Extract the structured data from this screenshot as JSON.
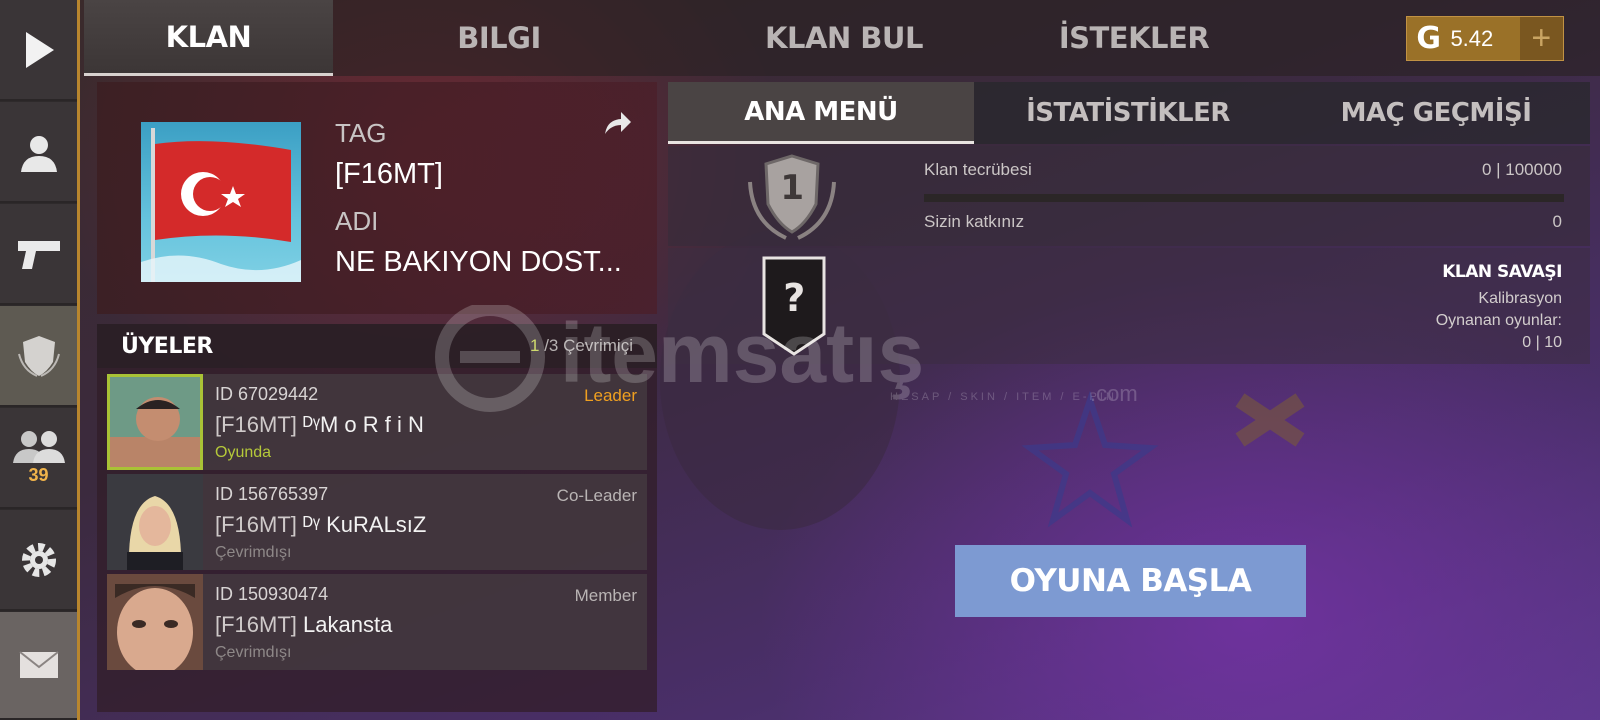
{
  "tabs": [
    "KLAN",
    "BILGI",
    "KLAN BUL",
    "İSTEKLER"
  ],
  "currency": {
    "symbol": "G",
    "value": "5.42",
    "add": "+"
  },
  "sidebar": {
    "friends_count": "39"
  },
  "clan": {
    "tag_label": "TAG",
    "tag_value": "[F16MT]",
    "name_label": "ADI",
    "name_value": "NE BAKIYON DOST..."
  },
  "members": {
    "title": "ÜYELER",
    "online_count": "1",
    "online_rest": "/3 Çevrimiçi",
    "rows": [
      {
        "id": "ID 67029442",
        "role": "Leader",
        "tag": "[F16MT]",
        "name": "ᴰᵞM o R f i N",
        "status": "Oyunda"
      },
      {
        "id": "ID 156765397",
        "role": "Co-Leader",
        "tag": "[F16MT]",
        "name": "ᴰᵞ KuRALsıZ",
        "status": "Çevrimdışı"
      },
      {
        "id": "ID 150930474",
        "role": "Member",
        "tag": "[F16MT]",
        "name": "Lakansta",
        "status": "Çevrimdışı"
      }
    ]
  },
  "subtabs": [
    "ANA MENÜ",
    "İSTATİSTİKLER",
    "MAÇ GEÇMİŞİ"
  ],
  "level": "1",
  "rank_badge": "?",
  "xp": {
    "label": "Klan tecrübesi",
    "value": "0 | 100000",
    "progress": 0,
    "contribution_label": "Sizin katkınız",
    "contribution_value": "0"
  },
  "war": {
    "title": "KLAN SAVAŞI",
    "status": "Kalibrasyon",
    "games_label": "Oynanan oyunlar:",
    "games_value": "0 | 10"
  },
  "play_button": "OYUNA BAŞLA",
  "watermark": {
    "brand": "itemsatış",
    "tagline": "HESAP / SKIN / ITEM / E-PIN",
    "domain": ".com"
  }
}
